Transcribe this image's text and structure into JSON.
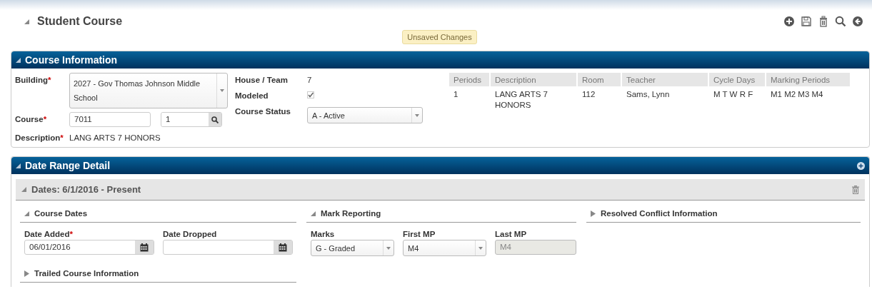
{
  "page": {
    "title": "Student Course",
    "expanded": true
  },
  "status_badge": "Unsaved Changes",
  "course_information": {
    "title": "Course Information",
    "expanded": true,
    "building": {
      "label": "Building",
      "required_mark": "*",
      "value": "2027 - Gov Thomas Johnson Middle School"
    },
    "course": {
      "label": "Course",
      "required_mark": "*",
      "value": "7011",
      "section": "1"
    },
    "description": {
      "label": "Description",
      "required_mark": "*",
      "value": "LANG ARTS 7 HONORS"
    },
    "house_team": {
      "label": "House / Team",
      "value": "7"
    },
    "modeled": {
      "label": "Modeled",
      "checked": true
    },
    "course_status": {
      "label": "Course Status",
      "value": "A - Active"
    },
    "table": {
      "columns": [
        "Periods",
        "Description",
        "Room",
        "Teacher",
        "Cycle Days",
        "Marking Periods"
      ],
      "rows": [
        [
          "1",
          "LANG ARTS 7 HONORS",
          "112",
          "Sams, Lynn",
          "M T W R F",
          "M1 M2 M3 M4"
        ]
      ]
    }
  },
  "date_range_detail": {
    "title": "Date Range Detail",
    "expanded": true,
    "range": {
      "title": "Dates: 6/1/2016 - Present",
      "expanded": true,
      "course_dates": {
        "title": "Course Dates",
        "expanded": true,
        "date_added": {
          "label": "Date Added",
          "required_mark": "*",
          "value": "06/01/2016"
        },
        "date_dropped": {
          "label": "Date Dropped"
        }
      },
      "trailed": {
        "title": "Trailed Course Information",
        "expanded": false
      },
      "mark_reporting": {
        "title": "Mark Reporting",
        "expanded": true,
        "fields": [
          {
            "label": "Marks",
            "kind": "select",
            "value": "G - Graded",
            "disabled": false
          },
          {
            "label": "First MP",
            "kind": "select",
            "value": "M4",
            "disabled": false
          },
          {
            "label": "Last MP",
            "kind": "text",
            "value": "M4",
            "disabled": true
          }
        ]
      },
      "resolved": {
        "title": "Resolved Conflict Information",
        "expanded": false
      }
    }
  }
}
